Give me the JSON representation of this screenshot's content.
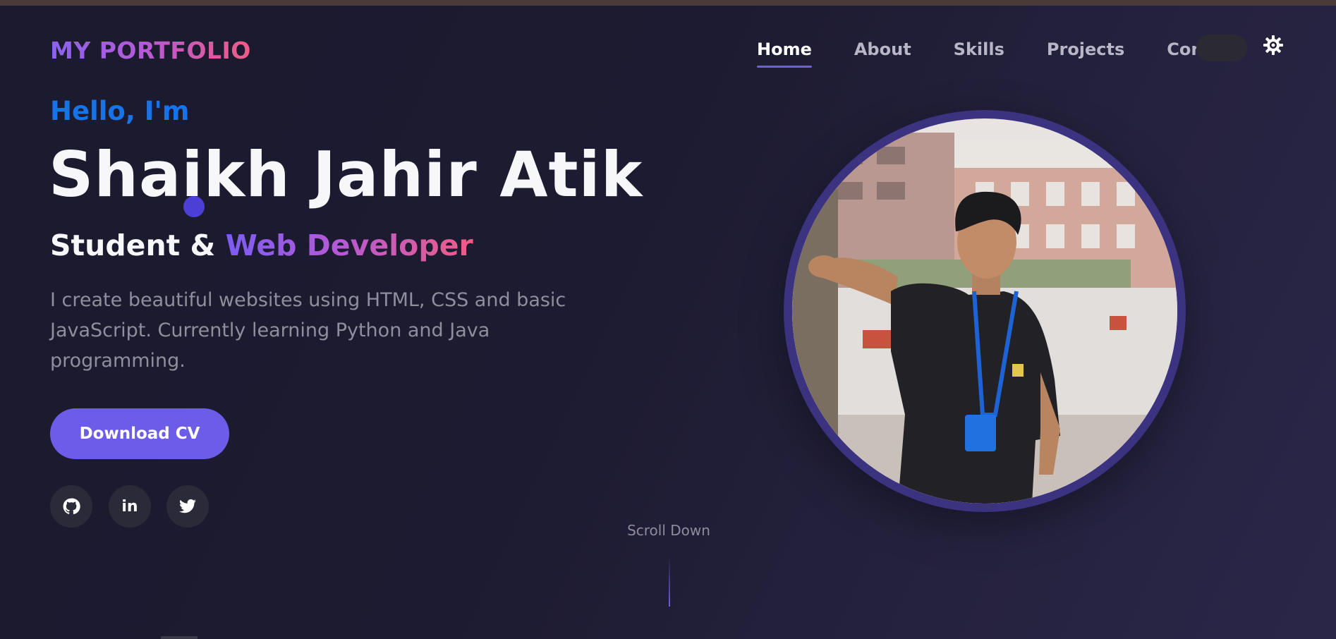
{
  "header": {
    "logo": "MY PORTFOLIO",
    "nav": [
      {
        "label": "Home",
        "active": true
      },
      {
        "label": "About",
        "active": false
      },
      {
        "label": "Skills",
        "active": false
      },
      {
        "label": "Projects",
        "active": false
      },
      {
        "label": "Contac",
        "active": false
      }
    ],
    "theme_icon": "gear-icon"
  },
  "hero": {
    "greeting": "Hello, I'm",
    "name": "Shaikh Jahir Atik",
    "role_prefix": "Student & ",
    "role_highlight": "Web Developer",
    "description": "I create beautiful websites using HTML, CSS and basic JavaScript. Currently learning Python and Java programming.",
    "cv_button": "Download CV",
    "socials": [
      {
        "name": "github",
        "icon": "github-icon"
      },
      {
        "name": "linkedin",
        "icon": "linkedin-icon",
        "text": "in"
      },
      {
        "name": "twitter",
        "icon": "twitter-icon"
      }
    ]
  },
  "scroll": {
    "label": "Scroll Down"
  },
  "colors": {
    "accent": "#6c5ce7",
    "greeting_blue": "#1773e8",
    "background": "#1d1b31",
    "gradient_start": "#7b5df2",
    "gradient_end": "#ef5c84"
  }
}
